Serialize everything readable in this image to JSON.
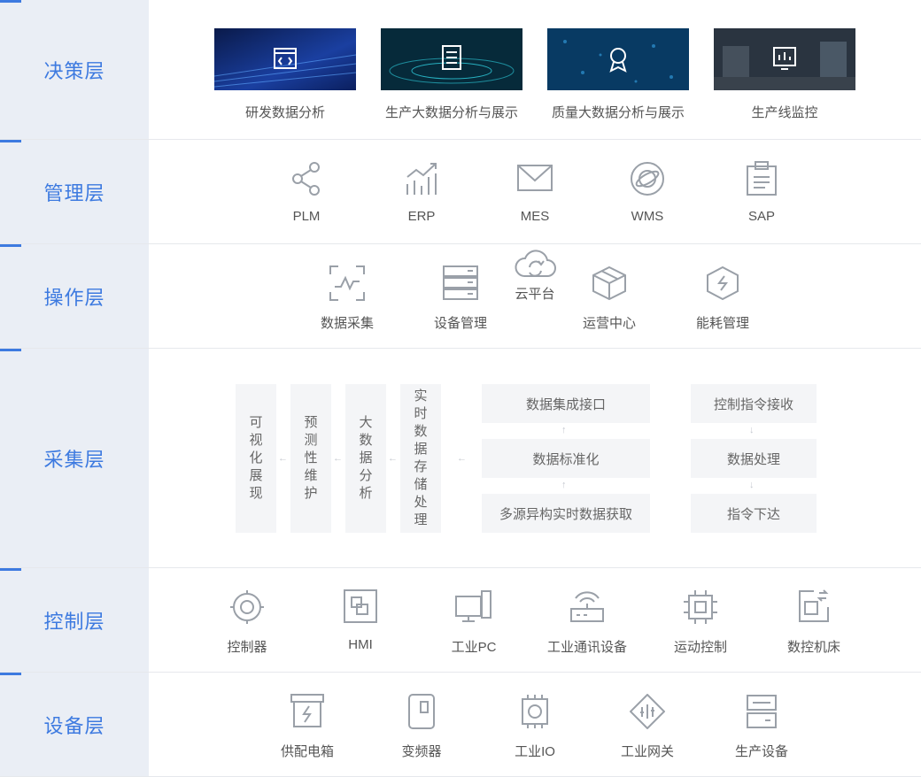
{
  "layers": {
    "decision": {
      "label": "决策层",
      "items": [
        "研发数据分析",
        "生产大数据分析与展示",
        "质量大数据分析与展示",
        "生产线监控"
      ]
    },
    "management": {
      "label": "管理层",
      "items": [
        "PLM",
        "ERP",
        "MES",
        "WMS",
        "SAP"
      ]
    },
    "operation": {
      "label": "操作层",
      "items": [
        "数据采集",
        "设备管理",
        "云平台",
        "运营中心",
        "能耗管理"
      ]
    },
    "collection": {
      "label": "采集层",
      "vertical": [
        "可视化展现",
        "预测性维护",
        "大数据分析",
        "实时数据存储处理"
      ],
      "center": [
        "数据集成接口",
        "数据标准化",
        "多源异构实时数据获取"
      ],
      "right": [
        "控制指令接收",
        "数据处理",
        "指令下达"
      ]
    },
    "control": {
      "label": "控制层",
      "items": [
        "控制器",
        "HMI",
        "工业PC",
        "工业通讯设备",
        "运动控制",
        "数控机床"
      ]
    },
    "device": {
      "label": "设备层",
      "items": [
        "供配电箱",
        "变频器",
        "工业IO",
        "工业网关",
        "生产设备"
      ]
    }
  },
  "colors": {
    "accent": "#3d7ae0",
    "icon": "#9aa0a8",
    "label_bg": "#eaeef5"
  },
  "icons": {
    "decision": [
      "code-icon",
      "dashboard-icon",
      "award-icon",
      "monitor-chart-icon"
    ],
    "management": [
      "share-icon",
      "trend-chart-icon",
      "mail-icon",
      "planet-icon",
      "clipboard-icon"
    ],
    "operation": [
      "pulse-scan-icon",
      "server-icon",
      "cloud-sync-icon",
      "cube-icon",
      "energy-hexagon-icon"
    ],
    "control": [
      "controller-icon",
      "hmi-icon",
      "pc-icon",
      "router-icon",
      "chip-icon",
      "cnc-icon"
    ],
    "device": [
      "power-box-icon",
      "inverter-icon",
      "io-chip-icon",
      "gateway-icon",
      "equipment-icon"
    ]
  }
}
